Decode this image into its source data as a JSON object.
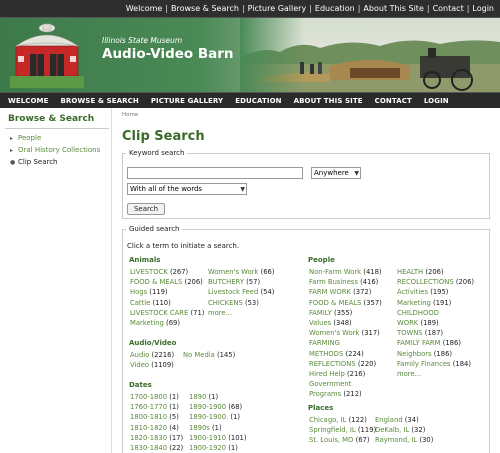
{
  "top_nav": [
    "Welcome",
    "Browse & Search",
    "Picture Gallery",
    "Education",
    "About This Site",
    "Contact",
    "Login"
  ],
  "site": {
    "subtitle": "Illinois State Museum",
    "title": "Audio-Video Barn"
  },
  "main_nav": [
    "WELCOME",
    "BROWSE & SEARCH",
    "PICTURE GALLERY",
    "EDUCATION",
    "ABOUT THIS SITE",
    "CONTACT",
    "LOGIN"
  ],
  "sidebar": {
    "heading": "Browse & Search",
    "items": [
      {
        "label": "People",
        "active": false
      },
      {
        "label": "Oral History Collections",
        "active": false
      },
      {
        "label": "Clip Search",
        "active": true
      }
    ]
  },
  "breadcrumb": "Home",
  "page_title": "Clip Search",
  "keyword": {
    "legend": "Keyword search",
    "value": "",
    "mode": "Anywhere",
    "scope": "With all of the words",
    "button": "Search"
  },
  "guided": {
    "legend": "Guided search",
    "instruction": "Click a term to initiate a search.",
    "animals": {
      "heading": "Animals",
      "col1": [
        {
          "term": "LIVESTOCK",
          "count": "(267)"
        },
        {
          "term": "FOOD & MEALS",
          "count": "(206)"
        },
        {
          "term": "Hogs",
          "count": "(119)"
        },
        {
          "term": "Cattle",
          "count": "(110)"
        },
        {
          "term": "LIVESTOCK CARE",
          "count": "(71)"
        },
        {
          "term": "Marketing",
          "count": "(69)"
        }
      ],
      "col2": [
        {
          "term": "Women's Work",
          "count": "(66)"
        },
        {
          "term": "BUTCHERY",
          "count": "(57)"
        },
        {
          "term": "Livestock Feed",
          "count": "(54)"
        },
        {
          "term": "CHICKENS",
          "count": "(53)"
        },
        {
          "term": "more...",
          "count": ""
        }
      ]
    },
    "audio_video": {
      "heading": "Audio/Video",
      "col1": [
        {
          "term": "Audio",
          "count": "(2216)"
        },
        {
          "term": "Video",
          "count": "(1109)"
        }
      ],
      "col2": [
        {
          "term": "No Media",
          "count": "(145)"
        }
      ]
    },
    "dates": {
      "heading": "Dates",
      "col1": [
        {
          "term": "1700-1800",
          "count": "(1)"
        },
        {
          "term": "1760-1770",
          "count": "(1)"
        },
        {
          "term": "1800-1810",
          "count": "(5)"
        },
        {
          "term": "1810-1820",
          "count": "(4)"
        },
        {
          "term": "1820-1830",
          "count": "(17)"
        },
        {
          "term": "1830-1840",
          "count": "(22)"
        }
      ],
      "col2": [
        {
          "term": "1890",
          "count": "(1)"
        },
        {
          "term": "1890-1900",
          "count": "(68)"
        },
        {
          "term": "1890-1900.",
          "count": "(1)"
        },
        {
          "term": "1890s",
          "count": "(1)"
        },
        {
          "term": "1900-1910",
          "count": "(101)"
        },
        {
          "term": "1900-1920",
          "count": "(1)"
        }
      ]
    },
    "people": {
      "heading": "People",
      "col1": [
        {
          "term": "Non-Farm Work",
          "count": "(418)"
        },
        {
          "term": "Farm Business",
          "count": "(416)"
        },
        {
          "term": "FARM WORK",
          "count": "(372)"
        },
        {
          "term": "FOOD & MEALS",
          "count": "(357)"
        },
        {
          "term": "FAMILY",
          "count": "(355)"
        },
        {
          "term": "Values",
          "count": "(348)"
        },
        {
          "term": "Women's Work",
          "count": "(317)"
        },
        {
          "term": "FARMING",
          "count": ""
        },
        {
          "term": "METHODS",
          "count": "(224)"
        },
        {
          "term": "REFLECTIONS",
          "count": "(220)"
        },
        {
          "term": "Hired Help",
          "count": "(216)"
        },
        {
          "term": "Government",
          "count": ""
        },
        {
          "term": "Programs",
          "count": "(212)"
        }
      ],
      "col2": [
        {
          "term": "HEALTH",
          "count": "(206)"
        },
        {
          "term": "RECOLLECTIONS",
          "count": "(206)"
        },
        {
          "term": "Activities",
          "count": "(195)"
        },
        {
          "term": "Marketing",
          "count": "(191)"
        },
        {
          "term": "CHILDHOOD",
          "count": ""
        },
        {
          "term": "WORK",
          "count": "(189)"
        },
        {
          "term": "TOWNS",
          "count": "(187)"
        },
        {
          "term": "FAMILY FARM",
          "count": "(186)"
        },
        {
          "term": "Neighbors",
          "count": "(186)"
        },
        {
          "term": "Family Finances",
          "count": "(184)"
        },
        {
          "term": "more...",
          "count": ""
        }
      ]
    },
    "places": {
      "heading": "Places",
      "col1": [
        {
          "term": "Chicago, IL",
          "count": "(122)"
        },
        {
          "term": "Springfield, IL",
          "count": "(119)"
        },
        {
          "term": "St. Louis, MO",
          "count": "(67)"
        }
      ],
      "col2": [
        {
          "term": "England",
          "count": "(34)"
        },
        {
          "term": "DeKalb, IL",
          "count": "(32)"
        },
        {
          "term": "Raymond, IL",
          "count": "(30)"
        }
      ]
    }
  }
}
